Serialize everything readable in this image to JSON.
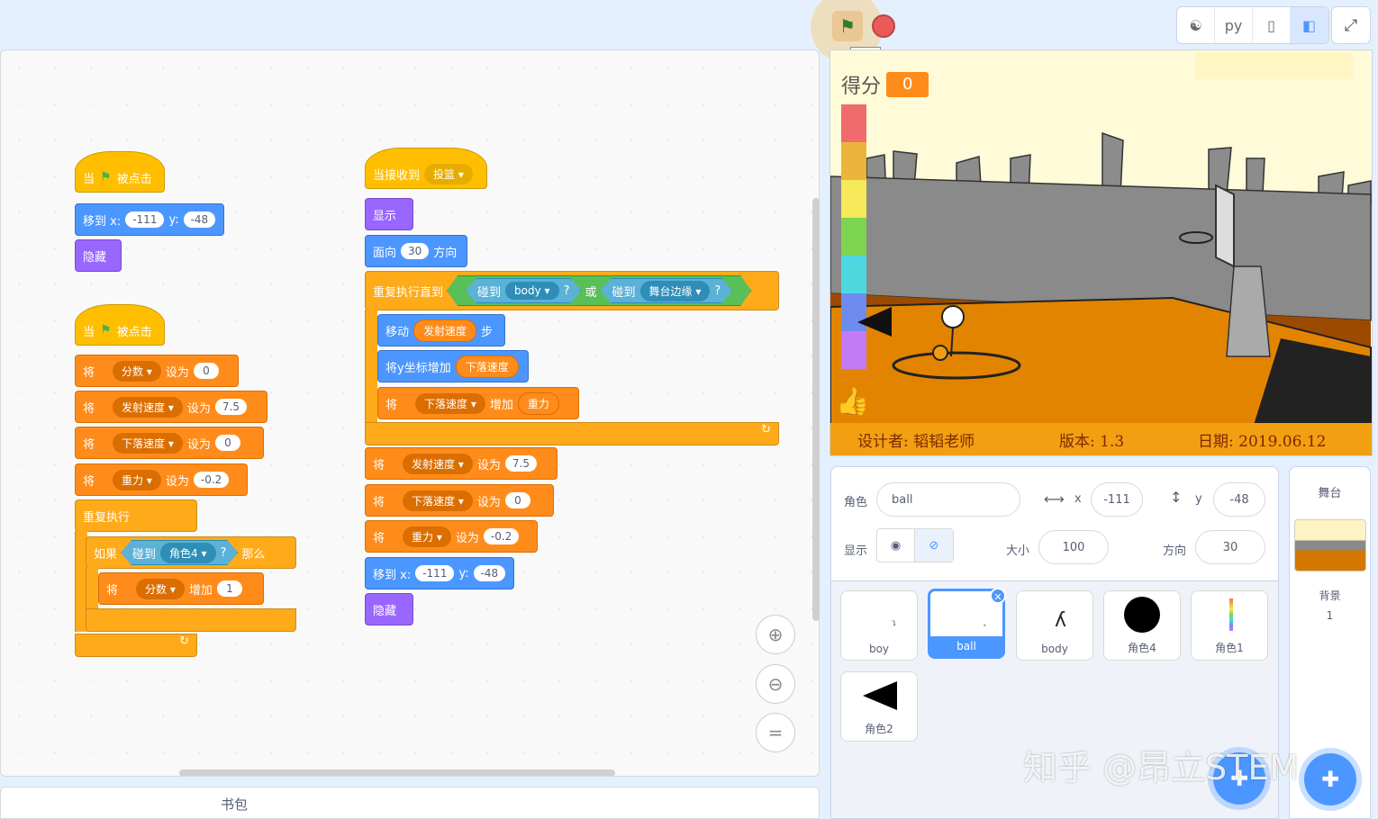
{
  "toolbar": {
    "run_tooltip": "运行",
    "python_label": "py"
  },
  "workspace": {
    "script1": {
      "hat_pre": "当",
      "hat_post": "被点击",
      "goto": "移到 x:",
      "goto_y": "y:",
      "x": "-111",
      "y": "-48",
      "hide": "隐藏"
    },
    "script2": {
      "hat_pre": "当",
      "hat_post": "被点击",
      "set_word": "将",
      "to_word": "设为",
      "change_word": "增加",
      "sets": [
        {
          "var": "分数",
          "val": "0"
        },
        {
          "var": "发射速度",
          "val": "7.5"
        },
        {
          "var": "下落速度",
          "val": "0"
        },
        {
          "var": "重力",
          "val": "-0.2"
        }
      ],
      "forever": "重复执行",
      "if": "如果",
      "touching": "碰到",
      "target": "角色4",
      "q": "?",
      "then": "那么",
      "change_var": "分数",
      "change_val": "1"
    },
    "script3": {
      "hat": "当接收到",
      "msg": "投篮",
      "show": "显示",
      "point": "面向",
      "dir": "30",
      "dir_word": "方向",
      "repeat_until": "重复执行直到",
      "touch1": "碰到",
      "t1": "body",
      "q": "?",
      "or": "或",
      "touch2": "碰到",
      "t2": "舞台边缘",
      "move": "移动",
      "move_var": "发射速度",
      "steps": "步",
      "change_y": "将y坐标增加",
      "change_y_var": "下落速度",
      "set_word": "将",
      "change_word": "增加",
      "to_word": "设为",
      "fall_var": "下落速度",
      "gravity": "重力",
      "sets": [
        {
          "var": "发射速度",
          "val": "7.5"
        },
        {
          "var": "下落速度",
          "val": "0"
        },
        {
          "var": "重力",
          "val": "-0.2"
        }
      ],
      "goto": "移到 x:",
      "goto_y": "y:",
      "x": "-111",
      "y": "-48",
      "hide": "隐藏"
    }
  },
  "backpack": "书包",
  "stage": {
    "score_label": "得分",
    "score": "0",
    "footer_designer": "设计者: 韬韬老师",
    "footer_version": "版本: 1.3",
    "footer_date": "日期: 2019.06.12"
  },
  "sprite_info": {
    "sprite_label": "角色",
    "sprite_name": "ball",
    "x_label": "x",
    "x": "-111",
    "y_label": "y",
    "y": "-48",
    "show_label": "显示",
    "size_label": "大小",
    "size": "100",
    "direction_label": "方向",
    "direction": "30"
  },
  "sprites": [
    {
      "name": "boy"
    },
    {
      "name": "ball"
    },
    {
      "name": "body"
    },
    {
      "name": "角色4"
    },
    {
      "name": "角色1"
    },
    {
      "name": "角色2"
    }
  ],
  "stage_panel": {
    "title": "舞台",
    "backdrop_label": "背景",
    "backdrop_count": "1"
  },
  "watermark": "知乎 @昂立STEM"
}
